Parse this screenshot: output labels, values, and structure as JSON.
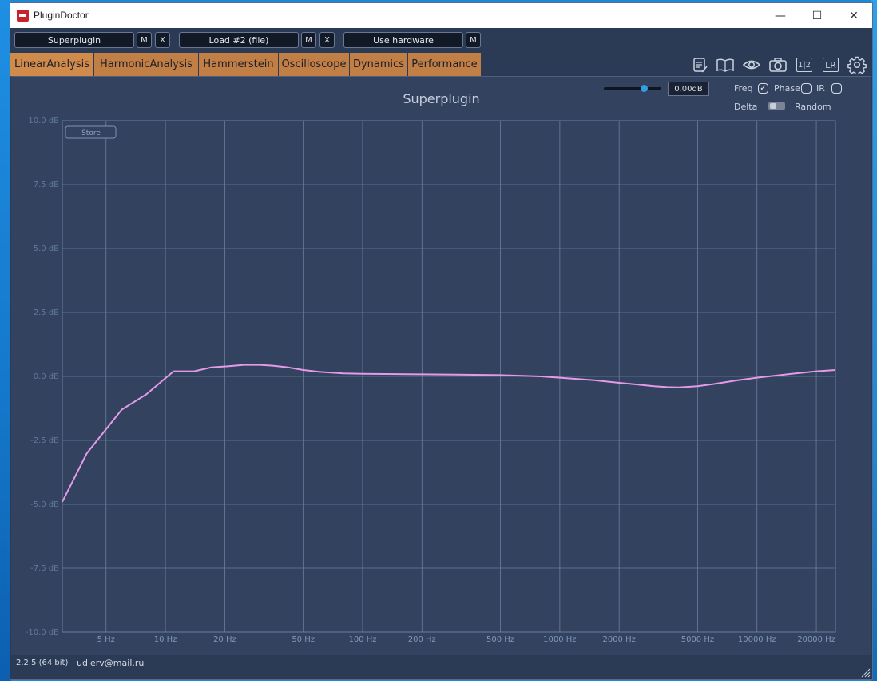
{
  "window": {
    "title": "PluginDoctor",
    "min_glyph": "—",
    "max_glyph": "☐",
    "close_glyph": "✕"
  },
  "toolbar": {
    "plugin_slot": "Superplugin",
    "plugin_m": "M",
    "plugin_x": "X",
    "load_slot": "Load #2 (file)",
    "load_m": "M",
    "load_x": "X",
    "hardware_slot": "Use hardware",
    "hardware_m": "M"
  },
  "tabs": [
    "LinearAnalysis",
    "HarmonicAnalysis",
    "Hammerstein",
    "Oscilloscope",
    "Dynamics",
    "Performance"
  ],
  "tool_icons": [
    "notes-icon",
    "book-icon",
    "eye-icon",
    "camera-icon",
    "compare-1-2-icon",
    "lr-icon",
    "gear-icon"
  ],
  "tool_text": {
    "compare": "1|2",
    "lr": "LR"
  },
  "controls": {
    "gain_value": "0.00dB",
    "gain_fraction": 0.7,
    "freq_label": "Freq",
    "phase_label": "Phase",
    "ir_label": "IR",
    "delta_label": "Delta",
    "random_label": "Random",
    "freq_checked": true,
    "phase_checked": false,
    "ir_checked": false,
    "check_glyph": "✓"
  },
  "store_label": "Store",
  "footer": {
    "version": "2.2.5 (64 bit)",
    "email": "udlerv@mail.ru"
  },
  "colors": {
    "trace": "#e59ae8",
    "grid": "#6a7f9f",
    "tab": "#c17f45",
    "panel": "#33425e",
    "accent": "#2fa0e0"
  },
  "chart_data": {
    "type": "line",
    "title": "Superplugin",
    "xscale": "log",
    "xlim": [
      3,
      25000
    ],
    "ylim": [
      -10,
      10
    ],
    "grid": true,
    "y_ticks": [
      10,
      7.5,
      5,
      2.5,
      0,
      -2.5,
      -5,
      -7.5,
      -10
    ],
    "y_tick_labels": [
      "10.0 dB",
      "7.5 dB",
      "5.0 dB",
      "2.5 dB",
      "0.0 dB",
      "-2.5 dB",
      "-5.0 dB",
      "-7.5 dB",
      "-10.0 dB"
    ],
    "x_ticks": [
      5,
      10,
      20,
      50,
      100,
      200,
      500,
      1000,
      2000,
      5000,
      10000,
      20000
    ],
    "x_tick_labels": [
      "5 Hz",
      "10 Hz",
      "20 Hz",
      "50 Hz",
      "100 Hz",
      "200 Hz",
      "500 Hz",
      "1000 Hz",
      "2000 Hz",
      "5000 Hz",
      "10000 Hz",
      "20000 Hz"
    ],
    "series": [
      {
        "x": [
          3,
          4,
          6,
          8,
          11,
          14,
          17,
          21,
          25,
          30,
          35,
          42,
          50,
          60,
          80,
          100,
          150,
          200,
          300,
          500,
          800,
          1000,
          1500,
          2000,
          2500,
          3000,
          3500,
          4000,
          5000,
          6000,
          8000,
          10000,
          15000,
          20000,
          25000
        ],
        "y": [
          -4.9,
          -3.0,
          -1.3,
          -0.7,
          0.2,
          0.2,
          0.35,
          0.4,
          0.45,
          0.45,
          0.42,
          0.35,
          0.25,
          0.18,
          0.12,
          0.1,
          0.09,
          0.08,
          0.07,
          0.05,
          0.0,
          -0.05,
          -0.15,
          -0.25,
          -0.32,
          -0.38,
          -0.42,
          -0.43,
          -0.38,
          -0.3,
          -0.15,
          -0.05,
          0.1,
          0.2,
          0.25
        ]
      }
    ]
  }
}
